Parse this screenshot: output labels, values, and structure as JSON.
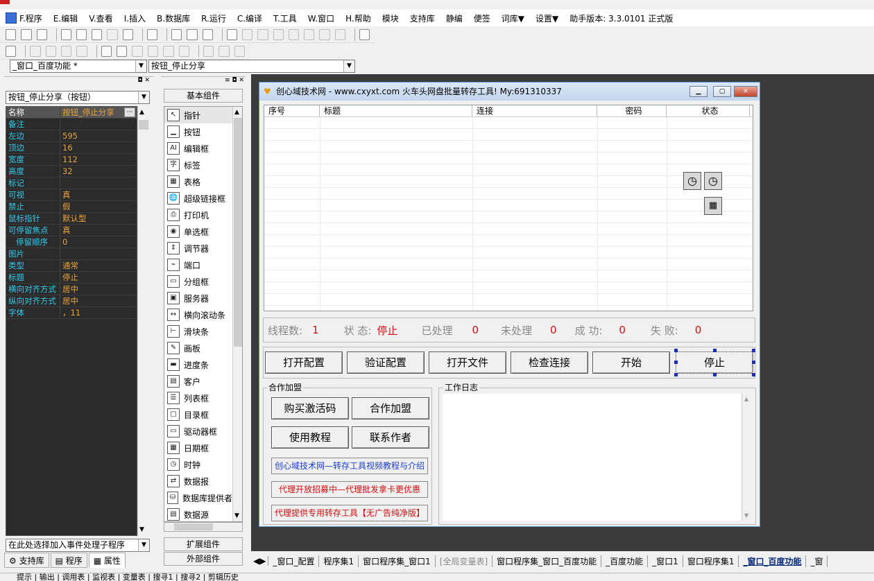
{
  "menu": [
    "F.程序",
    "E.编辑",
    "V.查看",
    "I.插入",
    "B.数据库",
    "R.运行",
    "C.编译",
    "T.工具",
    "W.窗口",
    "H.帮助",
    "模块",
    "支持库",
    "静编",
    "便签",
    "词库▼",
    "设置▼",
    "助手版本: 3.3.0101 正式版"
  ],
  "selectors": {
    "window": "_窗口_百度功能 *",
    "component": "按钮_停止分享"
  },
  "left_panel": {
    "object_combo": "按钮_停止分享（按钮）",
    "properties": [
      {
        "k": "名称",
        "v": "按钮_停止分享"
      },
      {
        "k": "备注",
        "v": ""
      },
      {
        "k": "左边",
        "v": "595"
      },
      {
        "k": "顶边",
        "v": "16"
      },
      {
        "k": "宽度",
        "v": "112"
      },
      {
        "k": "高度",
        "v": "32"
      },
      {
        "k": "标记",
        "v": ""
      },
      {
        "k": "可视",
        "v": "真"
      },
      {
        "k": "禁止",
        "v": "假"
      },
      {
        "k": "鼠标指针",
        "v": "默认型"
      },
      {
        "k": "可停留焦点",
        "v": "真"
      },
      {
        "k": "停留顺序",
        "v": "0"
      },
      {
        "k": "图片",
        "v": ""
      },
      {
        "k": "类型",
        "v": "通常"
      },
      {
        "k": "标题",
        "v": "停止"
      },
      {
        "k": "横向对齐方式",
        "v": "居中"
      },
      {
        "k": "纵向对齐方式",
        "v": "居中"
      },
      {
        "k": "字体",
        "v": "，11"
      }
    ],
    "event_combo": "在此处选择加入事件处理子程序",
    "tabs": [
      "支持库",
      "程序",
      "属性"
    ]
  },
  "components": {
    "header": "基本组件",
    "items": [
      {
        "label": "指针",
        "icon": "pointer-icon",
        "glyph": "↖"
      },
      {
        "label": "按钮",
        "icon": "button-icon",
        "glyph": "▁"
      },
      {
        "label": "编辑框",
        "icon": "edit-box-icon",
        "glyph": "AI"
      },
      {
        "label": "标签",
        "icon": "label-icon",
        "glyph": "字"
      },
      {
        "label": "表格",
        "icon": "table-icon",
        "glyph": "▦"
      },
      {
        "label": "超级链接框",
        "icon": "hyperlink-icon",
        "glyph": "🌐"
      },
      {
        "label": "打印机",
        "icon": "printer-icon",
        "glyph": "⎙"
      },
      {
        "label": "单选框",
        "icon": "radio-icon",
        "glyph": "◉"
      },
      {
        "label": "调节器",
        "icon": "spinner-icon",
        "glyph": "⇕"
      },
      {
        "label": "端口",
        "icon": "port-icon",
        "glyph": "⌁"
      },
      {
        "label": "分组框",
        "icon": "groupbox-icon",
        "glyph": "▭"
      },
      {
        "label": "服务器",
        "icon": "server-icon",
        "glyph": "▣"
      },
      {
        "label": "横向滚动条",
        "icon": "hscroll-icon",
        "glyph": "↔"
      },
      {
        "label": "滑块条",
        "icon": "slider-icon",
        "glyph": "⊢"
      },
      {
        "label": "画板",
        "icon": "canvas-icon",
        "glyph": "✎"
      },
      {
        "label": "进度条",
        "icon": "progress-icon",
        "glyph": "▬"
      },
      {
        "label": "客户",
        "icon": "client-icon",
        "glyph": "▤"
      },
      {
        "label": "列表框",
        "icon": "listbox-icon",
        "glyph": "☰"
      },
      {
        "label": "目录框",
        "icon": "directory-icon",
        "glyph": "▢"
      },
      {
        "label": "驱动器框",
        "icon": "drive-icon",
        "glyph": "▭"
      },
      {
        "label": "日期框",
        "icon": "date-icon",
        "glyph": "▦"
      },
      {
        "label": "时钟",
        "icon": "clock-icon",
        "glyph": "◷"
      },
      {
        "label": "数据报",
        "icon": "datagram-icon",
        "glyph": "⇄"
      },
      {
        "label": "数据库提供者",
        "icon": "db-provider-icon",
        "glyph": "⛁"
      },
      {
        "label": "数据源",
        "icon": "datasource-icon",
        "glyph": "▤"
      }
    ],
    "ext": "扩展组件",
    "external": "外部组件"
  },
  "form": {
    "title": "创心域技术网 - www.cxyxt.com 火车头网盘批量转存工具!    My:691310337",
    "columns": [
      "序号",
      "标题",
      "连接",
      "密码",
      "状态"
    ],
    "status": [
      {
        "label": "线程数:",
        "value": "1"
      },
      {
        "label": "状  态:",
        "value": "停止"
      },
      {
        "label": "已处理",
        "value": "0"
      },
      {
        "label": "未处理",
        "value": "0"
      },
      {
        "label": "成  功:",
        "value": "0"
      },
      {
        "label": "失  败:",
        "value": "0"
      }
    ],
    "buttons": [
      "打开配置",
      "验证配置",
      "打开文件",
      "检查连接",
      "开始",
      "停止"
    ],
    "coop_title": "合作加盟",
    "coop_buttons": [
      "购买激活码",
      "合作加盟",
      "使用教程",
      "联系作者"
    ],
    "links": [
      "创心域技术网—转存工具视频教程与介绍",
      "代理开放招募中—代理批发拿卡更优惠",
      "代理提供专用转存工具【无广告纯净版】"
    ],
    "log_title": "工作日志"
  },
  "bottom_tabs": [
    "_窗口_配置",
    "程序集1",
    "窗口程序集_窗口1",
    "[全局变量表]",
    "窗口程序集_窗口_百度功能",
    "_百度功能",
    "_窗口1",
    "窗口程序集1",
    "_窗口_百度功能",
    "_窗"
  ],
  "status_line": [
    "提示",
    "输出",
    "调用表",
    "监视表",
    "变量表",
    "搜寻1",
    "搜寻2",
    "剪辑历史"
  ]
}
